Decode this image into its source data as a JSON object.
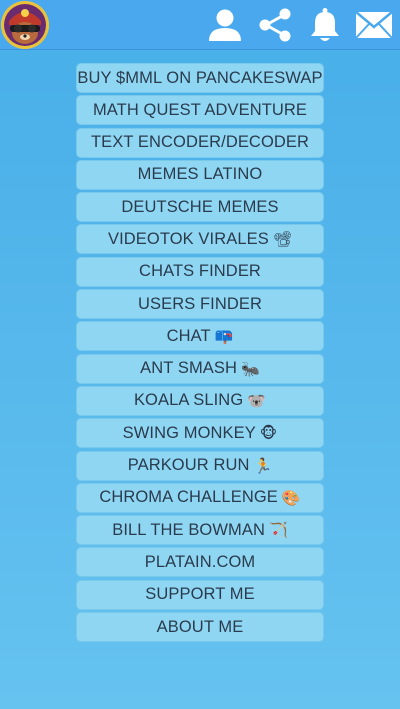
{
  "header": {
    "avatar_name": "profile-avatar",
    "icons": [
      "user-icon",
      "share-icon",
      "bell-icon",
      "mail-icon"
    ]
  },
  "colors": {
    "background_top": "#47aee8",
    "background_bottom": "#66c3f0",
    "topbar": "#4aa9ee",
    "button_bg": "#8fd6f3",
    "button_text": "#2a3b4d",
    "icon": "#ffffff"
  },
  "menu": {
    "items": [
      {
        "label": "BUY $MML ON PANCAKESWAP",
        "emoji": ""
      },
      {
        "label": "MATH QUEST ADVENTURE",
        "emoji": ""
      },
      {
        "label": "TEXT ENCODER/DECODER",
        "emoji": ""
      },
      {
        "label": "MEMES LATINO",
        "emoji": ""
      },
      {
        "label": "DEUTSCHE MEMES",
        "emoji": ""
      },
      {
        "label": "VIDEOTOK VIRALES",
        "emoji": "📽"
      },
      {
        "label": "CHATS FINDER",
        "emoji": ""
      },
      {
        "label": "USERS FINDER",
        "emoji": ""
      },
      {
        "label": "CHAT",
        "emoji": "📪"
      },
      {
        "label": "ANT SMASH",
        "emoji": "🐜"
      },
      {
        "label": "KOALA SLING",
        "emoji": "🐨"
      },
      {
        "label": "SWING MONKEY",
        "emoji": "🐵"
      },
      {
        "label": "PARKOUR RUN",
        "emoji": "🏃"
      },
      {
        "label": "CHROMA CHALLENGE",
        "emoji": "🎨"
      },
      {
        "label": "BILL THE BOWMAN",
        "emoji": "🏹"
      },
      {
        "label": "PLATAIN.COM",
        "emoji": ""
      },
      {
        "label": "SUPPORT ME",
        "emoji": ""
      },
      {
        "label": "ABOUT ME",
        "emoji": ""
      }
    ]
  }
}
